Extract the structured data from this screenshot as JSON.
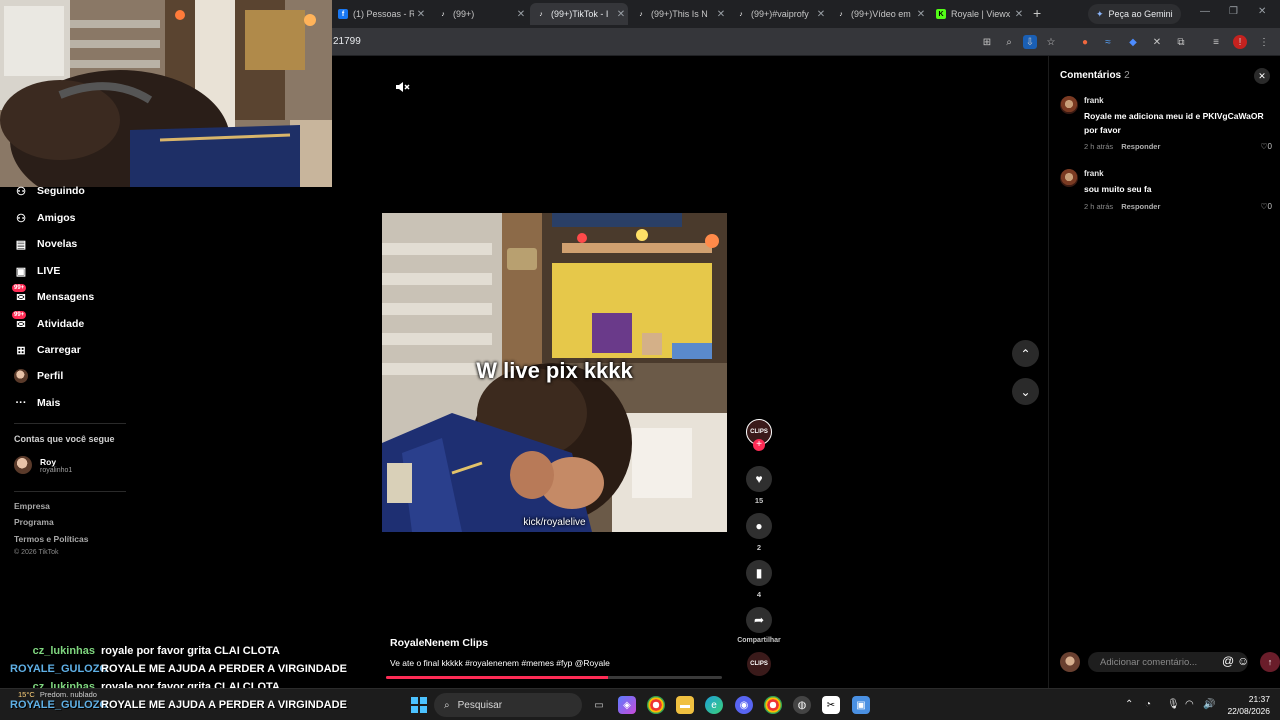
{
  "browser": {
    "tabs": [
      {
        "label": "(1) Pessoas - R",
        "icon": "facebook-icon",
        "active": false
      },
      {
        "label": "(99+)",
        "icon": "tiktok-icon",
        "active": false
      },
      {
        "label": "(99+)TikTok - I",
        "icon": "tiktok-icon",
        "active": true
      },
      {
        "label": "(99+)This Is N",
        "icon": "tiktok-icon",
        "active": false
      },
      {
        "label": "(99+)#vaiprofy",
        "icon": "tiktok-icon",
        "active": false
      },
      {
        "label": "(99+)Vídeo em",
        "icon": "tiktok-icon",
        "active": false
      },
      {
        "label": "Royale | Viewx",
        "icon": "kick-icon",
        "active": false
      }
    ],
    "new_tab": "+",
    "gemini_label": "Peça ao Gemini",
    "url_fragment": "21799"
  },
  "sidebar": {
    "items": [
      {
        "label": "Seguindo",
        "icon": "following-icon"
      },
      {
        "label": "Amigos",
        "icon": "friends-icon"
      },
      {
        "label": "Novelas",
        "icon": "novelas-icon"
      },
      {
        "label": "LIVE",
        "icon": "live-icon"
      },
      {
        "label": "Mensagens",
        "icon": "messages-icon",
        "badge": "99+"
      },
      {
        "label": "Atividade",
        "icon": "activity-icon",
        "badge": "99+"
      },
      {
        "label": "Carregar",
        "icon": "upload-icon"
      },
      {
        "label": "Perfil",
        "icon": "profile-icon"
      },
      {
        "label": "Mais",
        "icon": "more-icon"
      }
    ],
    "following_title": "Contas que você segue",
    "following": [
      {
        "name": "Roy",
        "handle": "royalinho1"
      }
    ],
    "footer": [
      "Empresa",
      "Programa",
      "Termos e Políticas"
    ],
    "copyright": "© 2026 TikTok"
  },
  "chat": [
    {
      "user": "cz_lukinhas",
      "user_color": "#7fd67f",
      "message": "royale por favor grita CLAI CLOTA"
    },
    {
      "user": "ROYALE_GULOZO",
      "user_color": "#5fb0e6",
      "message": "ROYALE ME AJUDA A PERDER A VIRGINDADE"
    },
    {
      "user": "cz_lukinhas",
      "user_color": "#7fd67f",
      "message": "royale por favor grita CLAI CLOTA"
    },
    {
      "user": "ROYALE_GULOZO",
      "user_color": "#5fb0e6",
      "message": "ROYALE ME AJUDA A PERDER A VIRGINDADE"
    }
  ],
  "video": {
    "caption": "W live pix kkkk",
    "watermark": "kick/royalelive",
    "author": "RoyaleNenem Clips",
    "description": "Ve ate o final kkkkk #royalenenem #memes #fyp @Royale",
    "progress": 0.66,
    "avatar_text": "CLIPS"
  },
  "actions": {
    "likes": "15",
    "comments": "2",
    "saves": "4",
    "share_label": "Compartilhar"
  },
  "comments_panel": {
    "title": "Comentários",
    "count": "2",
    "items": [
      {
        "user": "frank",
        "text": "Royale me adiciona meu id e PKIVgCaWaOR por favor",
        "time": "2 h atrás",
        "reply": "Responder",
        "likes": "0"
      },
      {
        "user": "frank",
        "text": "sou muito seu fa",
        "time": "2 h atrás",
        "reply": "Responder",
        "likes": "0"
      }
    ],
    "input_placeholder": "Adicionar comentário..."
  },
  "taskbar": {
    "search_placeholder": "Pesquisar",
    "time": "21:37",
    "date": "22/08/2026",
    "weather_temp": "15°C",
    "weather_text": "Predom. nublado"
  },
  "colors": {
    "accent": "#fe2c55",
    "background": "#000000"
  }
}
